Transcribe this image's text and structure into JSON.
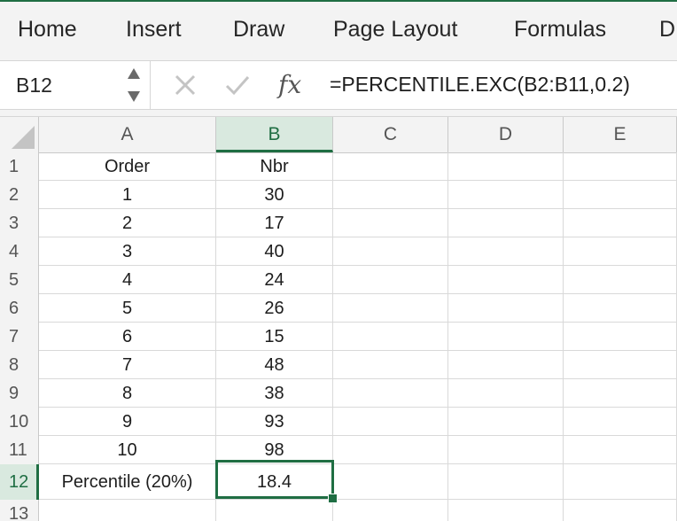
{
  "ribbon": {
    "tabs": [
      "Home",
      "Insert",
      "Draw",
      "Page Layout",
      "Formulas",
      "D"
    ]
  },
  "formula_bar": {
    "name_box": "B12",
    "formula": "=PERCENTILE.EXC(B2:B11,0.2)",
    "fx_label": "fx"
  },
  "sheet": {
    "columns": [
      "A",
      "B",
      "C",
      "D",
      "E"
    ],
    "active_column": "B",
    "active_row": "12",
    "rows": [
      {
        "num": "1",
        "a": "Order",
        "b": "Nbr"
      },
      {
        "num": "2",
        "a": "1",
        "b": "30"
      },
      {
        "num": "3",
        "a": "2",
        "b": "17"
      },
      {
        "num": "4",
        "a": "3",
        "b": "40"
      },
      {
        "num": "5",
        "a": "4",
        "b": "24"
      },
      {
        "num": "6",
        "a": "5",
        "b": "26"
      },
      {
        "num": "7",
        "a": "6",
        "b": "15"
      },
      {
        "num": "8",
        "a": "7",
        "b": "48"
      },
      {
        "num": "9",
        "a": "8",
        "b": "38"
      },
      {
        "num": "10",
        "a": "9",
        "b": "93"
      },
      {
        "num": "11",
        "a": "10",
        "b": "98"
      },
      {
        "num": "12",
        "a": "Percentile (20%)",
        "b": "18.4"
      },
      {
        "num": "13",
        "a": "",
        "b": ""
      }
    ]
  },
  "colors": {
    "accent": "#1f6e43",
    "header_bg": "#f3f3f3",
    "active_header_bg": "#d9e9df"
  }
}
